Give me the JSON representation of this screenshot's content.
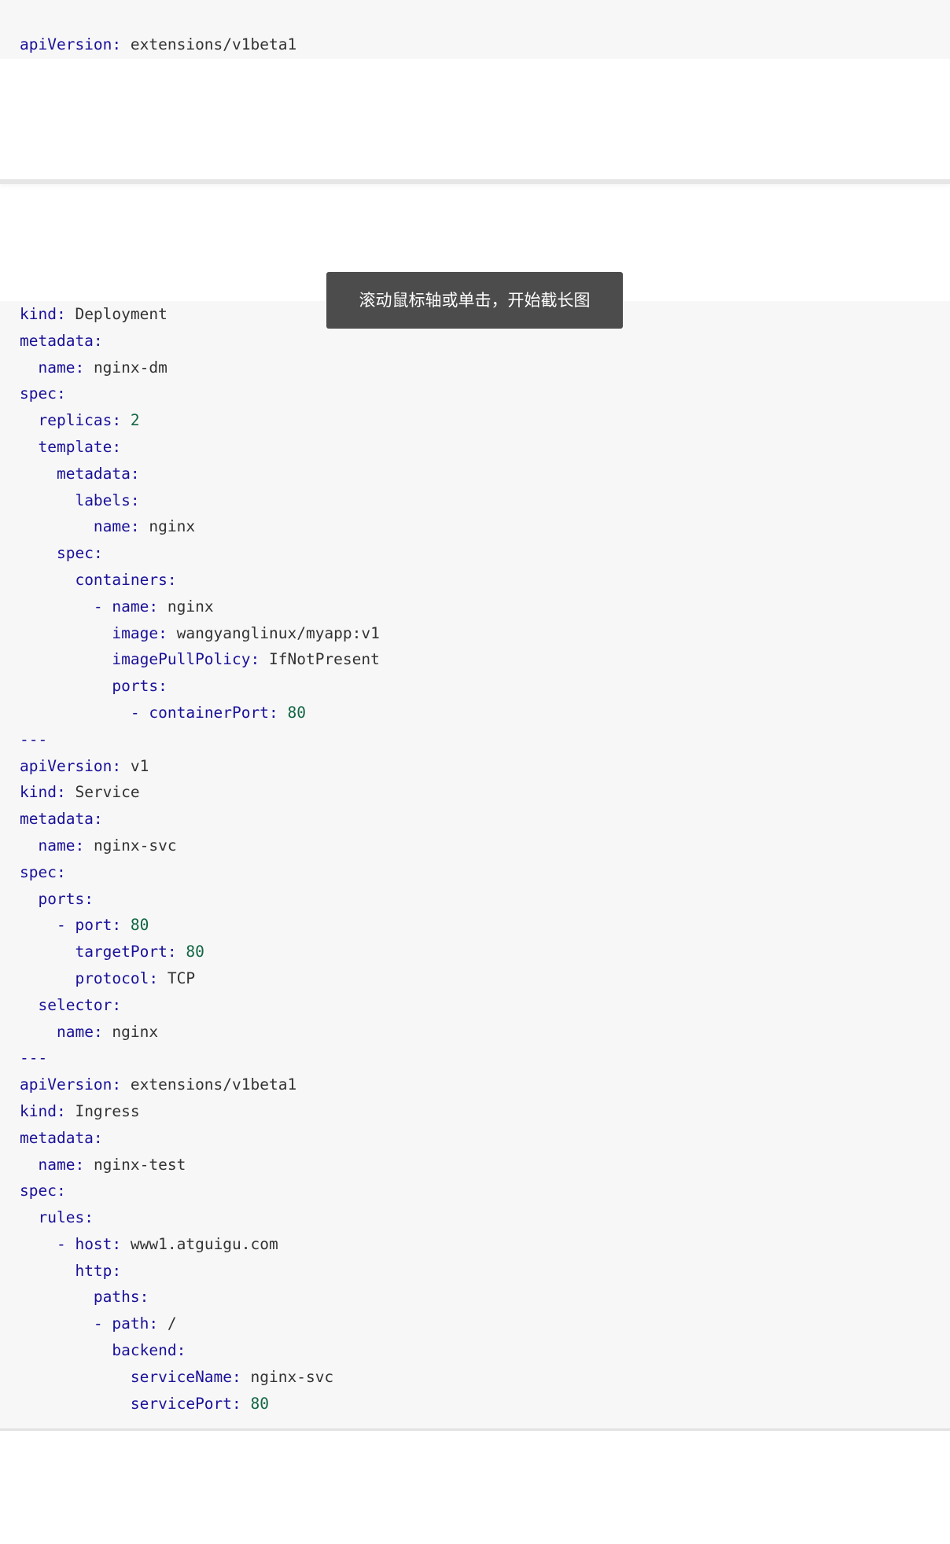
{
  "top_line": {
    "key": "apiVersion",
    "value": "extensions/v1beta1",
    "type": "str"
  },
  "tooltip": "滚动鼠标轴或单击，开始截长图",
  "code_lines": [
    {
      "indent": "",
      "key": "kind",
      "value": "Deployment",
      "type": "str"
    },
    {
      "indent": "",
      "key": "metadata",
      "value": "",
      "type": "str"
    },
    {
      "indent": "  ",
      "key": "name",
      "value": "nginx-dm",
      "type": "str"
    },
    {
      "indent": "",
      "key": "spec",
      "value": "",
      "type": "str"
    },
    {
      "indent": "  ",
      "key": "replicas",
      "value": "2",
      "type": "num"
    },
    {
      "indent": "  ",
      "key": "template",
      "value": "",
      "type": "str"
    },
    {
      "indent": "    ",
      "key": "metadata",
      "value": "",
      "type": "str"
    },
    {
      "indent": "      ",
      "key": "labels",
      "value": "",
      "type": "str"
    },
    {
      "indent": "        ",
      "key": "name",
      "value": "nginx",
      "type": "str"
    },
    {
      "indent": "    ",
      "key": "spec",
      "value": "",
      "type": "str"
    },
    {
      "indent": "      ",
      "key": "containers",
      "value": "",
      "type": "str"
    },
    {
      "indent": "        - ",
      "key": "name",
      "value": "nginx",
      "type": "str"
    },
    {
      "indent": "          ",
      "key": "image",
      "value": "wangyanglinux/myapp:v1",
      "type": "str"
    },
    {
      "indent": "          ",
      "key": "imagePullPolicy",
      "value": "IfNotPresent",
      "type": "str"
    },
    {
      "indent": "          ",
      "key": "ports",
      "value": "",
      "type": "str"
    },
    {
      "indent": "            - ",
      "key": "containerPort",
      "value": "80",
      "type": "num"
    },
    {
      "indent": "",
      "key": "",
      "value": "---",
      "type": "sep"
    },
    {
      "indent": "",
      "key": "apiVersion",
      "value": "v1",
      "type": "str"
    },
    {
      "indent": "",
      "key": "kind",
      "value": "Service",
      "type": "str"
    },
    {
      "indent": "",
      "key": "metadata",
      "value": "",
      "type": "str"
    },
    {
      "indent": "  ",
      "key": "name",
      "value": "nginx-svc",
      "type": "str"
    },
    {
      "indent": "",
      "key": "spec",
      "value": "",
      "type": "str"
    },
    {
      "indent": "  ",
      "key": "ports",
      "value": "",
      "type": "str"
    },
    {
      "indent": "    - ",
      "key": "port",
      "value": "80",
      "type": "num"
    },
    {
      "indent": "      ",
      "key": "targetPort",
      "value": "80",
      "type": "num"
    },
    {
      "indent": "      ",
      "key": "protocol",
      "value": "TCP",
      "type": "str"
    },
    {
      "indent": "  ",
      "key": "selector",
      "value": "",
      "type": "str"
    },
    {
      "indent": "    ",
      "key": "name",
      "value": "nginx",
      "type": "str"
    },
    {
      "indent": "",
      "key": "",
      "value": "---",
      "type": "sep"
    },
    {
      "indent": "",
      "key": "apiVersion",
      "value": "extensions/v1beta1",
      "type": "str"
    },
    {
      "indent": "",
      "key": "kind",
      "value": "Ingress",
      "type": "str"
    },
    {
      "indent": "",
      "key": "metadata",
      "value": "",
      "type": "str"
    },
    {
      "indent": "  ",
      "key": "name",
      "value": "nginx-test",
      "type": "str"
    },
    {
      "indent": "",
      "key": "spec",
      "value": "",
      "type": "str"
    },
    {
      "indent": "  ",
      "key": "rules",
      "value": "",
      "type": "str"
    },
    {
      "indent": "    - ",
      "key": "host",
      "value": "www1.atguigu.com",
      "type": "str"
    },
    {
      "indent": "      ",
      "key": "http",
      "value": "",
      "type": "str"
    },
    {
      "indent": "        ",
      "key": "paths",
      "value": "",
      "type": "str"
    },
    {
      "indent": "        - ",
      "key": "path",
      "value": "/",
      "type": "str"
    },
    {
      "indent": "          ",
      "key": "backend",
      "value": "",
      "type": "str"
    },
    {
      "indent": "            ",
      "key": "serviceName",
      "value": "nginx-svc",
      "type": "str"
    },
    {
      "indent": "            ",
      "key": "servicePort",
      "value": "80",
      "type": "num"
    }
  ]
}
